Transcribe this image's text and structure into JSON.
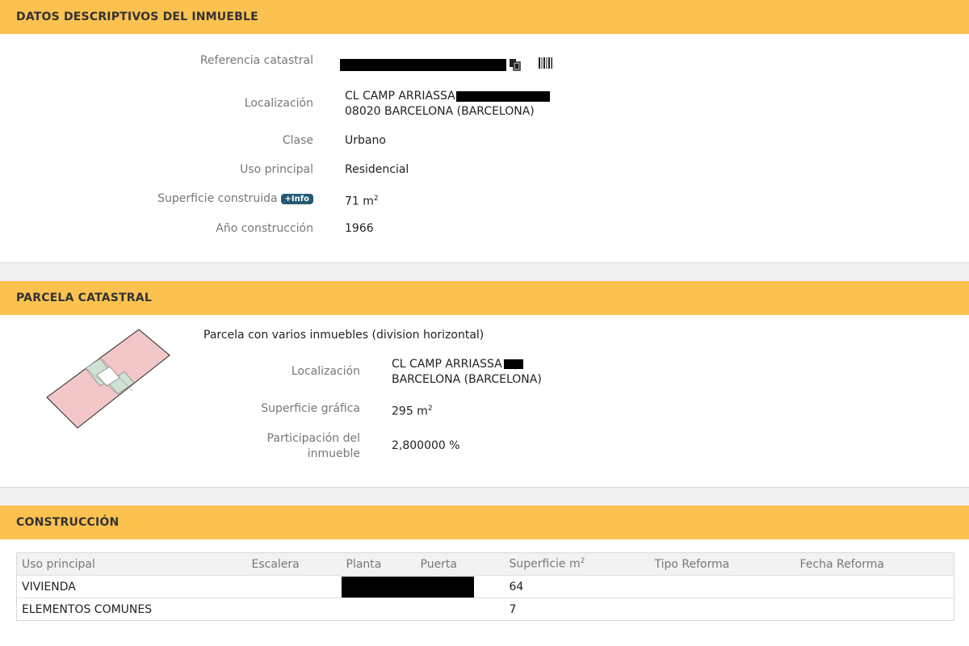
{
  "datos": {
    "header": "DATOS DESCRIPTIVOS DEL INMUEBLE",
    "ref_label": "Referencia catastral",
    "loc_label": "Localización",
    "loc_line1": "CL CAMP ARRIASSA",
    "loc_line2": "08020 BARCELONA (BARCELONA)",
    "clase_label": "Clase",
    "clase_value": "Urbano",
    "uso_label": "Uso principal",
    "uso_value": "Residencial",
    "sup_label": "Superficie construida",
    "sup_info": "+Info",
    "sup_value": "71 m",
    "sup_unit_exp": "2",
    "ano_label": "Año construcción",
    "ano_value": "1966"
  },
  "parcela": {
    "header": "PARCELA CATASTRAL",
    "desc": "Parcela con varios inmuebles (division horizontal)",
    "loc_label": "Localización",
    "loc_line1": "CL CAMP ARRIASSA",
    "loc_line2": "BARCELONA (BARCELONA)",
    "supg_label": "Superficie gráfica",
    "supg_value": "295 m",
    "supg_unit_exp": "2",
    "part_label_1": "Participación del",
    "part_label_2": "inmueble",
    "part_value": "2,800000 %"
  },
  "construccion": {
    "header": "CONSTRUCCIÓN",
    "columns": [
      "Uso principal",
      "Escalera",
      "Planta",
      "Puerta",
      "Superficie m",
      "Tipo Reforma",
      "Fecha Reforma"
    ],
    "sup_col_exp": "2",
    "rows": [
      {
        "uso": "VIVIENDA",
        "superficie": "64"
      },
      {
        "uso": "ELEMENTOS COMUNES",
        "superficie": "7"
      }
    ]
  },
  "icons": {
    "copy": "copy-icon",
    "barcode": "barcode-icon"
  },
  "colors": {
    "header_bg": "#fcc250",
    "badge_bg": "#245b74",
    "parcel_fill": "#f3c7c7",
    "parcel_common": "#cfe2d3"
  }
}
